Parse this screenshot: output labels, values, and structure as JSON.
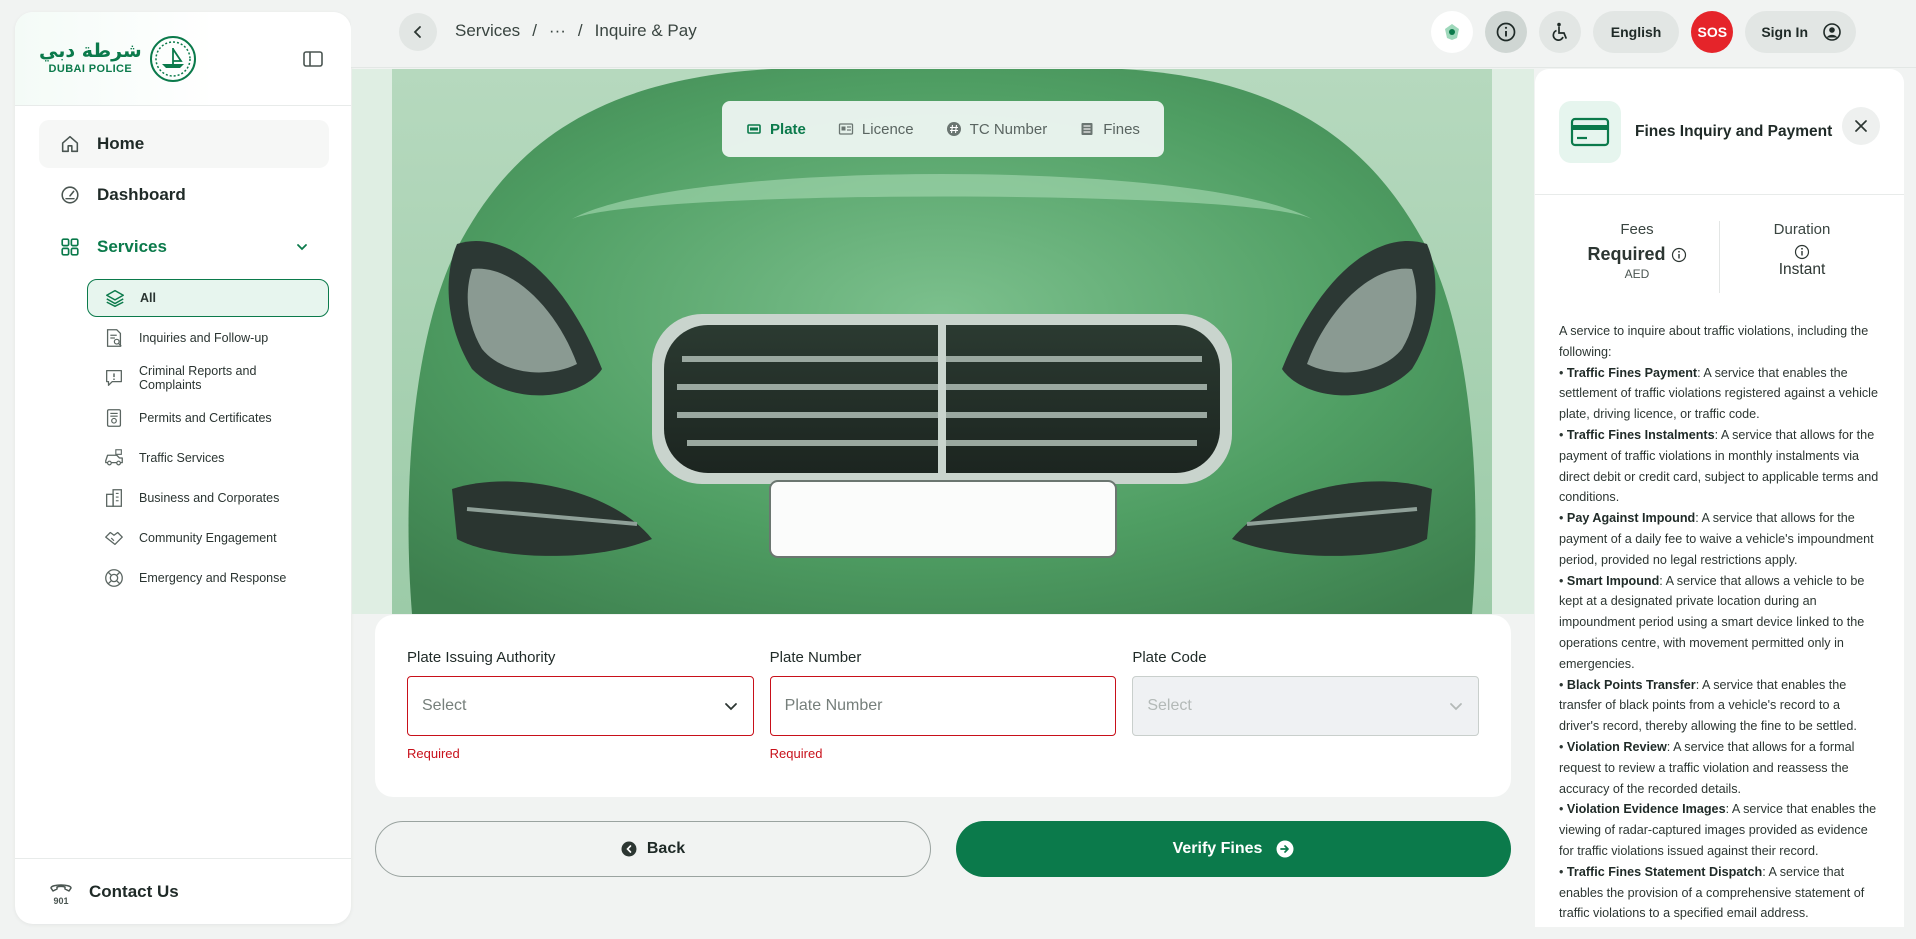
{
  "sidebar": {
    "logo_ar": "شرطة دبي",
    "logo_en": "DUBAI POLICE",
    "home": "Home",
    "dashboard": "Dashboard",
    "services": "Services",
    "sub_items": [
      {
        "label": "All",
        "icon": "layers-icon"
      },
      {
        "label": "Inquiries and Follow-up",
        "icon": "document-search-icon"
      },
      {
        "label": "Criminal Reports and Complaints",
        "icon": "report-icon"
      },
      {
        "label": "Permits and Certificates",
        "icon": "certificate-icon"
      },
      {
        "label": "Traffic Services",
        "icon": "car-icon"
      },
      {
        "label": "Business and Corporates",
        "icon": "building-icon"
      },
      {
        "label": "Community Engagement",
        "icon": "handshake-icon"
      },
      {
        "label": "Emergency and Response",
        "icon": "lifebuoy-icon"
      }
    ],
    "contact": "Contact Us",
    "contact_num": "901"
  },
  "topbar": {
    "crumb_services": "Services",
    "crumb_sep": "/",
    "crumb_more": "···",
    "crumb_current": "Inquire & Pay",
    "language": "English",
    "sos": "SOS",
    "sign_in": "Sign In"
  },
  "tabs": [
    {
      "label": "Plate",
      "icon": "plate-icon"
    },
    {
      "label": "Licence",
      "icon": "id-card-icon"
    },
    {
      "label": "TC Number",
      "icon": "hash-icon"
    },
    {
      "label": "Fines",
      "icon": "list-icon"
    }
  ],
  "form": {
    "authority_label": "Plate Issuing Authority",
    "authority_placeholder": "Select",
    "authority_error": "Required",
    "number_label": "Plate Number",
    "number_placeholder": "Plate Number",
    "number_error": "Required",
    "code_label": "Plate Code",
    "code_placeholder": "Select"
  },
  "actions": {
    "back": "Back",
    "verify": "Verify Fines"
  },
  "panel": {
    "title": "Fines Inquiry and Payment",
    "fees_label": "Fees",
    "fees_value": "Required",
    "fees_currency": "AED",
    "duration_label": "Duration",
    "duration_value": "Instant",
    "intro": "A service to inquire about traffic violations, including the following:",
    "items": [
      {
        "title": "Traffic Fines Payment",
        "text": ": A service that enables the settlement of traffic violations registered against a vehicle plate, driving licence, or traffic code."
      },
      {
        "title": "Traffic Fines Instalments",
        "text": ": A service that allows for the payment of traffic violations in monthly instalments via direct debit or credit card, subject to applicable terms and conditions."
      },
      {
        "title": "Pay Against Impound",
        "text": ": A service that allows for the payment of a daily fee to waive a vehicle's impoundment period, provided no legal restrictions apply."
      },
      {
        "title": "Smart Impound",
        "text": ": A service that allows a vehicle to be kept at a designated private location during an impoundment period using a smart device linked to the operations centre, with movement permitted only in emergencies."
      },
      {
        "title": "Black Points Transfer",
        "text": ": A service that enables the transfer of black points from a vehicle's record to a driver's record, thereby allowing the fine to be settled."
      },
      {
        "title": "Violation Review",
        "text": ": A service that allows for a formal request to review a traffic violation and reassess the accuracy of the recorded details."
      },
      {
        "title": "Violation Evidence Images",
        "text": ": A service that enables the viewing of radar-captured images provided as evidence for traffic violations issued against their record."
      },
      {
        "title": "Traffic Fines Statement Dispatch",
        "text": ": A service that enables the provision of a comprehensive statement of traffic violations to a specified email address."
      }
    ]
  },
  "colors": {
    "brand_green": "#0b7a4b",
    "error_red": "#c8101a",
    "sos_red": "#e5242a"
  }
}
